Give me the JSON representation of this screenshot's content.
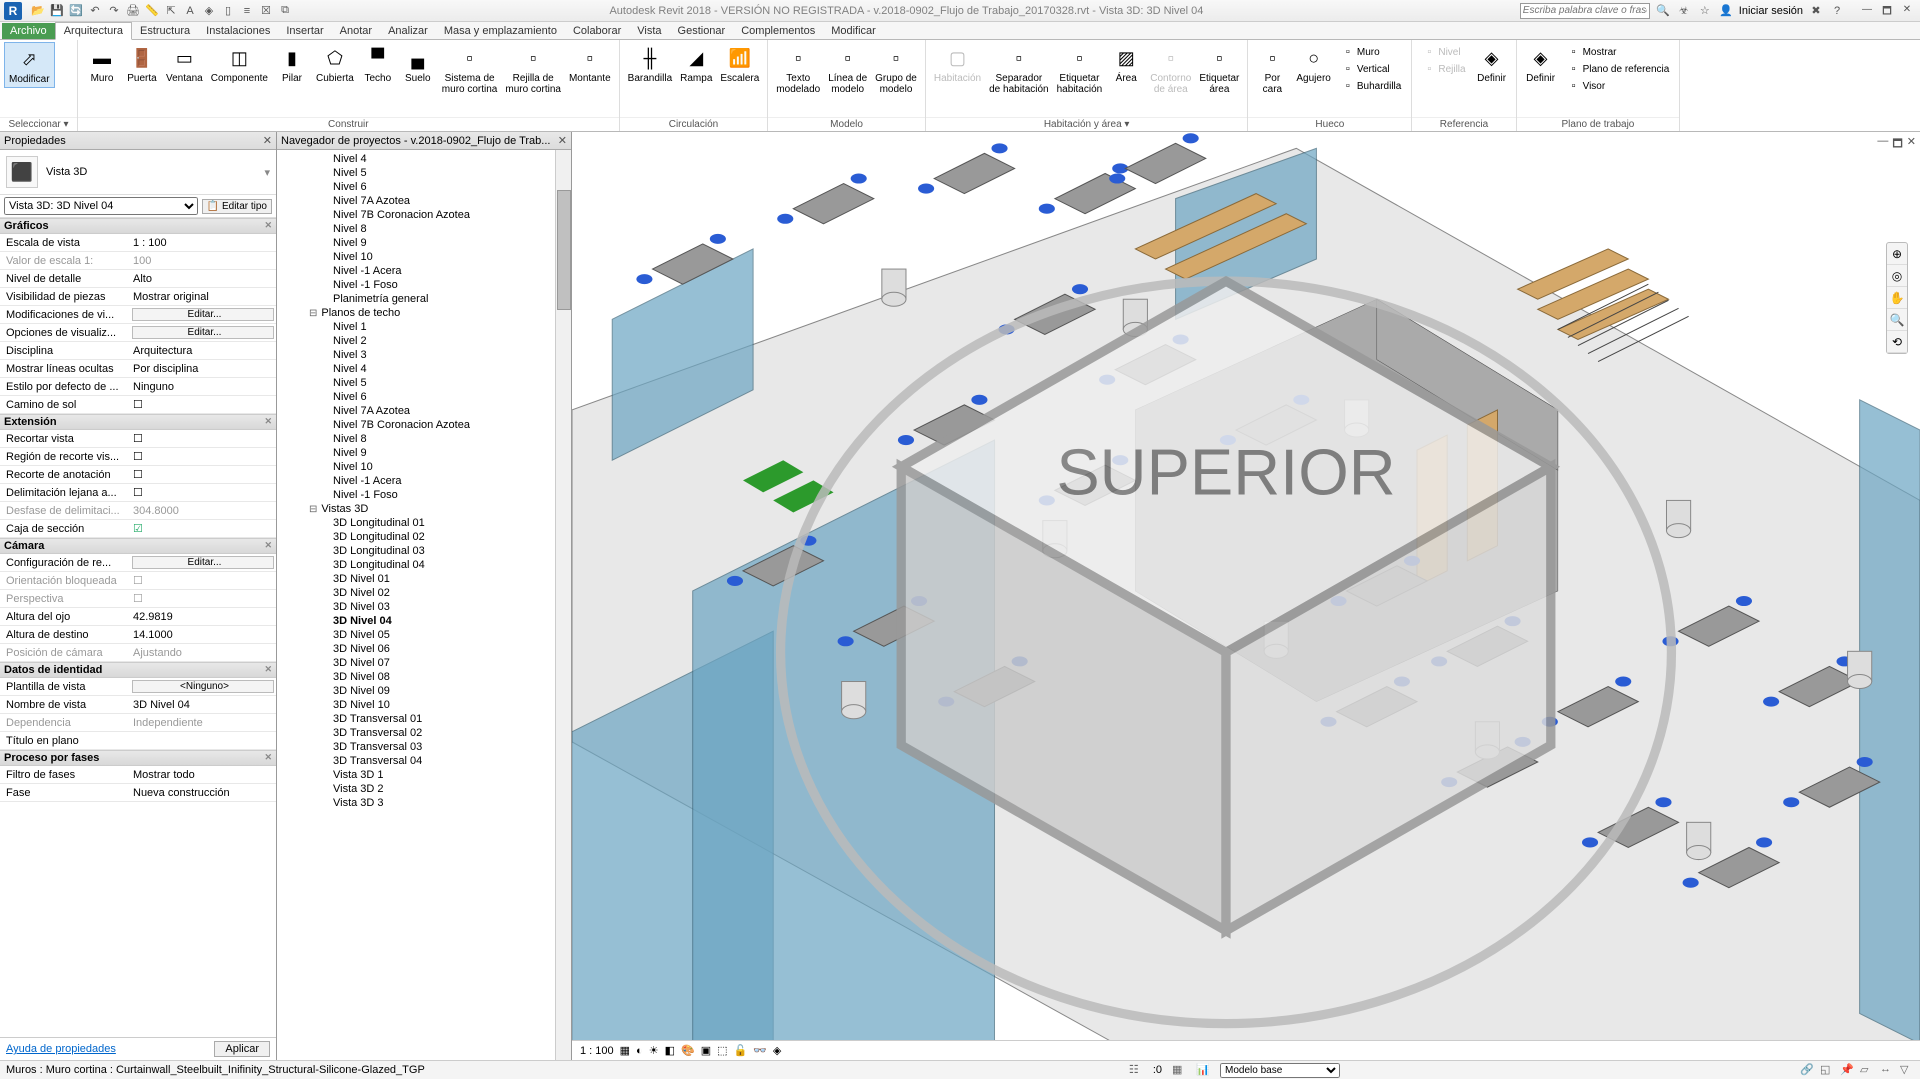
{
  "app": {
    "title": "Autodesk Revit 2018 - VERSIÓN NO REGISTRADA -   v.2018-0902_Flujo de Trabajo_20170328.rvt - Vista 3D: 3D Nivel 04",
    "search_placeholder": "Escriba palabra clave o frase",
    "login": "Iniciar sesión"
  },
  "menutabs": [
    "Archivo",
    "Arquitectura",
    "Estructura",
    "Instalaciones",
    "Insertar",
    "Anotar",
    "Analizar",
    "Masa y emplazamiento",
    "Colaborar",
    "Vista",
    "Gestionar",
    "Complementos",
    "Modificar"
  ],
  "ribbon": {
    "modify": {
      "label": "Modificar",
      "group": "Seleccionar ▾"
    },
    "construir": {
      "label": "Construir",
      "tools": [
        "Muro",
        "Puerta",
        "Ventana",
        "Componente",
        "Pilar",
        "Cubierta",
        "Techo",
        "Suelo",
        "Sistema de\nmuro cortina",
        "Rejilla de\nmuro cortina",
        "Montante"
      ]
    },
    "circ": {
      "label": "Circulación",
      "tools": [
        "Barandilla",
        "Rampa",
        "Escalera"
      ]
    },
    "modelo": {
      "label": "Modelo",
      "tools": [
        "Texto\nmodelado",
        "Línea de\nmodelo",
        "Grupo de\nmodelo"
      ]
    },
    "habit": {
      "label": "Habitación y área ▾",
      "tools": [
        "Habitación",
        "Separador\nde habitación",
        "Etiquetar\nhabitación",
        "Área",
        "Contorno\nde área",
        "Etiquetar\nárea"
      ]
    },
    "hueco": {
      "label": "Hueco",
      "tools": [
        "Por\ncara",
        "Agujero"
      ],
      "v": [
        "Muro",
        "Vertical",
        "Buhardilla"
      ]
    },
    "ref": {
      "label": "Referencia",
      "tools": [
        "Definir"
      ],
      "v": [
        "Nivel",
        "Rejilla"
      ]
    },
    "plano": {
      "label": "Plano de trabajo",
      "tools": [
        "Definir"
      ],
      "v": [
        "Mostrar",
        "Plano de referencia",
        "Visor"
      ]
    }
  },
  "properties": {
    "title": "Propiedades",
    "type_label": "Vista 3D",
    "instance_sel": "Vista 3D: 3D Nivel 04",
    "edit_type": "Editar tipo",
    "groups": [
      {
        "name": "Gráficos",
        "rows": [
          {
            "k": "Escala de vista",
            "v": "1 : 100"
          },
          {
            "k": "Valor de escala    1:",
            "v": "100",
            "dis": true
          },
          {
            "k": "Nivel de detalle",
            "v": "Alto"
          },
          {
            "k": "Visibilidad de piezas",
            "v": "Mostrar original"
          },
          {
            "k": "Modificaciones de vi...",
            "v": "Editar...",
            "btn": true
          },
          {
            "k": "Opciones de visualiz...",
            "v": "Editar...",
            "btn": true
          },
          {
            "k": "Disciplina",
            "v": "Arquitectura"
          },
          {
            "k": "Mostrar líneas ocultas",
            "v": "Por disciplina"
          },
          {
            "k": "Estilo por defecto de ...",
            "v": "Ninguno"
          },
          {
            "k": "Camino de sol",
            "v": "",
            "chk": true
          }
        ]
      },
      {
        "name": "Extensión",
        "rows": [
          {
            "k": "Recortar vista",
            "v": "",
            "chk": true
          },
          {
            "k": "Región de recorte vis...",
            "v": "",
            "chk": true
          },
          {
            "k": "Recorte de anotación",
            "v": "",
            "chk": true
          },
          {
            "k": "Delimitación lejana a...",
            "v": "",
            "chk": true
          },
          {
            "k": "Desfase de delimitaci...",
            "v": "304.8000",
            "dis": true
          },
          {
            "k": "Caja de sección",
            "v": "",
            "chk": true,
            "on": true
          }
        ]
      },
      {
        "name": "Cámara",
        "rows": [
          {
            "k": "Configuración de re...",
            "v": "Editar...",
            "btn": true
          },
          {
            "k": "Orientación bloqueada",
            "v": "",
            "chk": true,
            "dis": true
          },
          {
            "k": "Perspectiva",
            "v": "",
            "chk": true,
            "dis": true
          },
          {
            "k": "Altura del ojo",
            "v": "42.9819"
          },
          {
            "k": "Altura de destino",
            "v": "14.1000"
          },
          {
            "k": "Posición de cámara",
            "v": "Ajustando",
            "dis": true
          }
        ]
      },
      {
        "name": "Datos de identidad",
        "rows": [
          {
            "k": "Plantilla de vista",
            "v": "<Ninguno>",
            "btn": true
          },
          {
            "k": "Nombre de vista",
            "v": "3D Nivel 04"
          },
          {
            "k": "Dependencia",
            "v": "Independiente",
            "dis": true
          },
          {
            "k": "Título en plano",
            "v": ""
          }
        ]
      },
      {
        "name": "Proceso por fases",
        "rows": [
          {
            "k": "Filtro de fases",
            "v": "Mostrar todo"
          },
          {
            "k": "Fase",
            "v": "Nueva construcción"
          }
        ]
      }
    ],
    "help": "Ayuda de propiedades",
    "apply": "Aplicar"
  },
  "browser": {
    "title": "Navegador de proyectos - v.2018-0902_Flujo de Trab...",
    "items": [
      {
        "t": "Nivel 4"
      },
      {
        "t": "Nivel 5"
      },
      {
        "t": "Nivel 6"
      },
      {
        "t": "Nivel 7A Azotea"
      },
      {
        "t": "Nivel 7B Coronacion Azotea"
      },
      {
        "t": "Nivel 8"
      },
      {
        "t": "Nivel 9"
      },
      {
        "t": "Nivel 10"
      },
      {
        "t": "Nivel -1 Acera"
      },
      {
        "t": "Nivel -1 Foso"
      },
      {
        "t": "Planimetría general"
      },
      {
        "t": "Planos de techo",
        "l": 1
      },
      {
        "t": "Nivel 1"
      },
      {
        "t": "Nivel 2"
      },
      {
        "t": "Nivel 3"
      },
      {
        "t": "Nivel 4"
      },
      {
        "t": "Nivel 5"
      },
      {
        "t": "Nivel 6"
      },
      {
        "t": "Nivel 7A Azotea"
      },
      {
        "t": "Nivel 7B Coronacion Azotea"
      },
      {
        "t": "Nivel 8"
      },
      {
        "t": "Nivel 9"
      },
      {
        "t": "Nivel 10"
      },
      {
        "t": "Nivel -1 Acera"
      },
      {
        "t": "Nivel -1 Foso"
      },
      {
        "t": "Vistas 3D",
        "l": 1
      },
      {
        "t": "3D Longitudinal 01"
      },
      {
        "t": "3D Longitudinal 02"
      },
      {
        "t": "3D Longitudinal 03"
      },
      {
        "t": "3D Longitudinal 04"
      },
      {
        "t": "3D Nivel 01"
      },
      {
        "t": "3D Nivel 02"
      },
      {
        "t": "3D Nivel 03"
      },
      {
        "t": "3D Nivel 04",
        "b": true
      },
      {
        "t": "3D Nivel 05"
      },
      {
        "t": "3D Nivel 06"
      },
      {
        "t": "3D Nivel 07"
      },
      {
        "t": "3D Nivel 08"
      },
      {
        "t": "3D Nivel 09"
      },
      {
        "t": "3D Nivel 10"
      },
      {
        "t": "3D Transversal 01"
      },
      {
        "t": "3D Transversal 02"
      },
      {
        "t": "3D Transversal 03"
      },
      {
        "t": "3D Transversal 04"
      },
      {
        "t": "Vista 3D 1"
      },
      {
        "t": "Vista 3D 2"
      },
      {
        "t": "Vista 3D 3"
      }
    ]
  },
  "viewbar": {
    "scale": "1 : 100"
  },
  "status": {
    "text": "Muros : Muro cortina : Curtainwall_Steelbuilt_Inifinity_Structural-Silicone-Glazed_TGP",
    "count": ":0",
    "design_opt": "Modelo base"
  }
}
